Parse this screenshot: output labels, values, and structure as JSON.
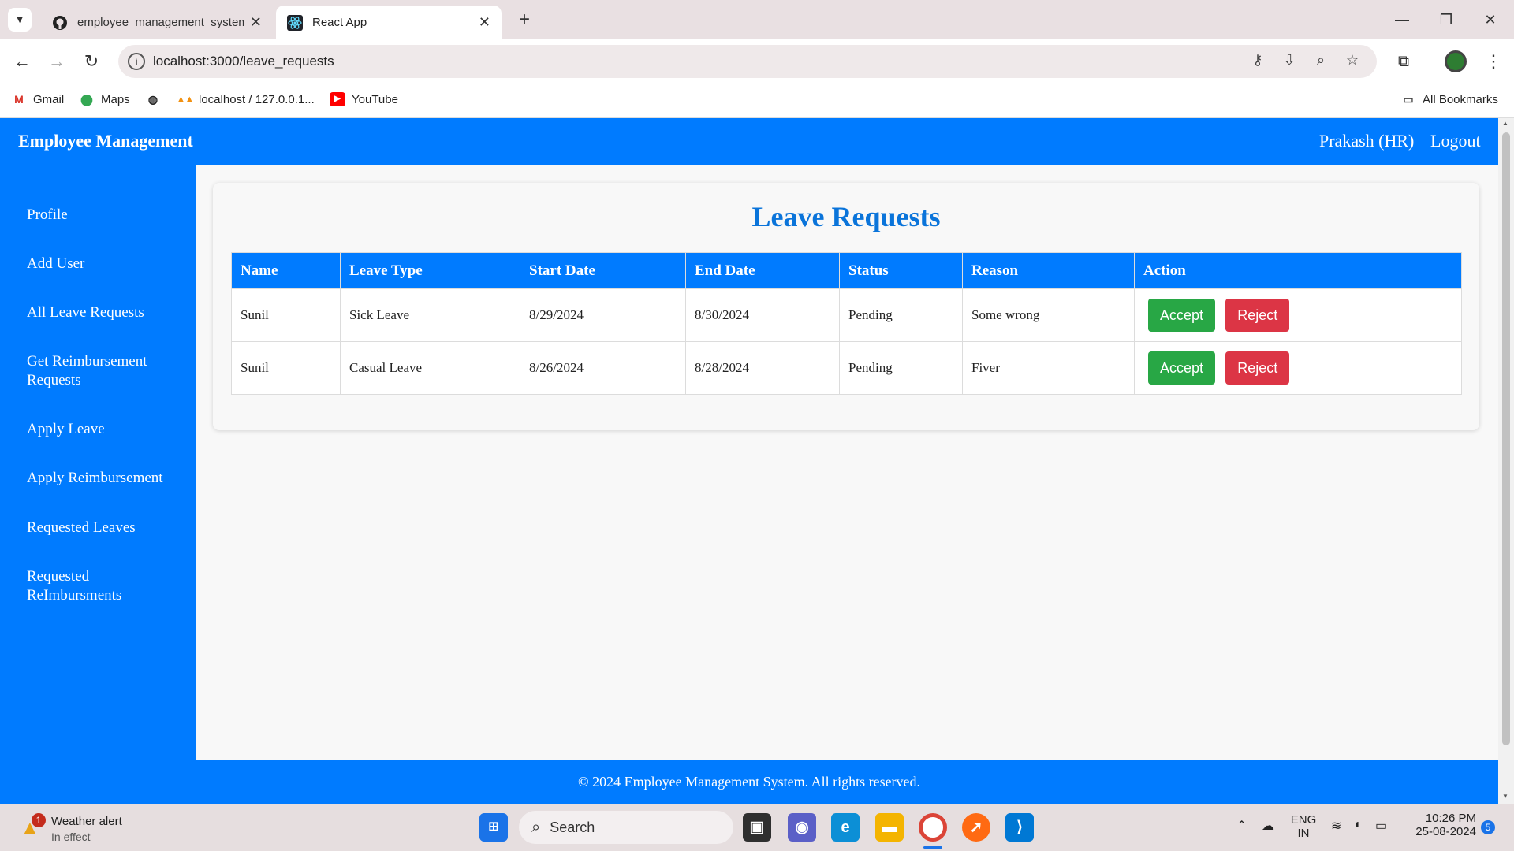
{
  "browser": {
    "tabs": [
      {
        "title": "employee_management_system",
        "icon": "github-icon",
        "active": false
      },
      {
        "title": "React App",
        "icon": "react-icon",
        "active": true
      }
    ],
    "new_tab_label": "+",
    "url": "localhost:3000/leave_requests",
    "bookmarks": [
      {
        "label": "Gmail",
        "icon": "gmail-icon"
      },
      {
        "label": "Maps",
        "icon": "maps-icon"
      },
      {
        "label": "",
        "icon": "globe-icon"
      },
      {
        "label": "localhost / 127.0.0.1...",
        "icon": "phpmyadmin-icon"
      },
      {
        "label": "YouTube",
        "icon": "youtube-icon"
      }
    ],
    "all_bookmarks": "All Bookmarks"
  },
  "header": {
    "brand": "Employee Management",
    "user": "Prakash (HR)",
    "logout": "Logout"
  },
  "sidebar": {
    "items": [
      {
        "label": "Profile"
      },
      {
        "label": "Add User"
      },
      {
        "label": "All Leave Requests"
      },
      {
        "label": "Get Reimbursement Requests"
      },
      {
        "label": "Apply Leave"
      },
      {
        "label": "Apply Reimbursement"
      },
      {
        "label": "Requested Leaves"
      },
      {
        "label": "Requested ReImbursments"
      }
    ]
  },
  "main": {
    "title": "Leave Requests",
    "columns": [
      "Name",
      "Leave Type",
      "Start Date",
      "End Date",
      "Status",
      "Reason",
      "Action"
    ],
    "rows": [
      {
        "name": "Sunil",
        "leave_type": "Sick Leave",
        "start": "8/29/2024",
        "end": "8/30/2024",
        "status": "Pending",
        "reason": "Some wrong"
      },
      {
        "name": "Sunil",
        "leave_type": "Casual Leave",
        "start": "8/26/2024",
        "end": "8/28/2024",
        "status": "Pending",
        "reason": "Fiver"
      }
    ],
    "accept_label": "Accept",
    "reject_label": "Reject"
  },
  "footer": {
    "text": "© 2024 Employee Management System. All rights reserved."
  },
  "taskbar": {
    "weather_title": "Weather alert",
    "weather_sub": "In effect",
    "weather_badge": "1",
    "search_label": "Search",
    "lang_top": "ENG",
    "lang_bottom": "IN",
    "time": "10:26 PM",
    "date": "25-08-2024",
    "notif_count": "5"
  },
  "colors": {
    "primary": "#007bff",
    "accept": "#28a745",
    "reject": "#dc3545",
    "title": "#0a74da"
  }
}
